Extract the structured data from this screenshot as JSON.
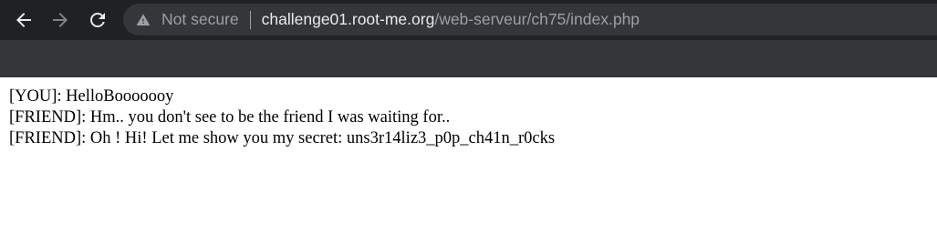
{
  "toolbar": {
    "icons": {
      "back": "arrow-left-icon",
      "forward": "arrow-right-icon",
      "reload": "reload-icon",
      "security": "warning-triangle-icon"
    },
    "colors": {
      "toolbar_bg": "#202124",
      "omnibox_bg": "#35363a",
      "bookmarks_bar_bg": "#35363a",
      "url_host": "#e8eaed",
      "url_dim": "#9aa0a6"
    }
  },
  "omnibox": {
    "security_label": "Not secure",
    "url_host": "challenge01.root-me.org",
    "url_path": "/web-serveur/ch75/index.php"
  },
  "page": {
    "lines": [
      "[YOU]: HelloBooooooy",
      "[FRIEND]: Hm.. you don't see to be the friend I was waiting for..",
      "[FRIEND]: Oh ! Hi! Let me show you my secret: uns3r14liz3_p0p_ch41n_r0cks"
    ]
  }
}
